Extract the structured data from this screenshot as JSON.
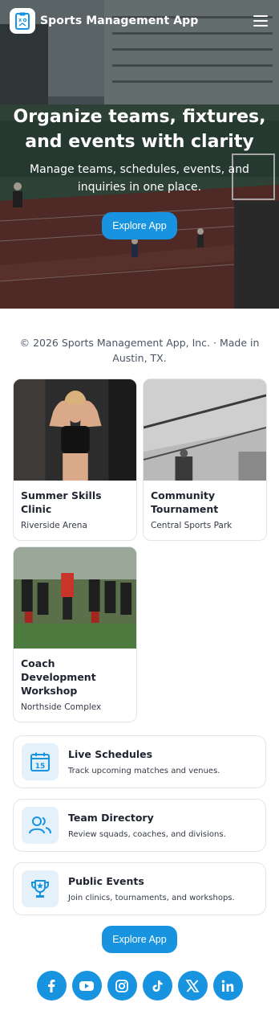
{
  "header": {
    "brand": "Sports Management App",
    "logo_icon": "clipboard-tactics-icon",
    "menu_icon": "hamburger-menu-icon"
  },
  "hero": {
    "title": "Organize teams, fixtures, and events with clarity",
    "subtitle": "Manage teams, schedules, events, and inquiries in one place.",
    "cta_label": "Explore App"
  },
  "copyright": "© 2026 Sports Management App, Inc. · Made in Austin, TX.",
  "events": [
    {
      "title": "Summer Skills Clinic",
      "location": "Riverside Arena",
      "image": "fitness-athlete-photo"
    },
    {
      "title": "Community Tournament",
      "location": "Central Sports Park",
      "image": "indoor-gym-photo"
    },
    {
      "title": "Coach Development Workshop",
      "location": "Northside Complex",
      "image": "football-team-photo"
    }
  ],
  "features": [
    {
      "title": "Live Schedules",
      "description": "Track upcoming matches and venues.",
      "icon": "calendar-icon",
      "icon_text": "15"
    },
    {
      "title": "Team Directory",
      "description": "Review squads, coaches, and divisions.",
      "icon": "users-icon"
    },
    {
      "title": "Public Events",
      "description": "Join clinics, tournaments, and workshops.",
      "icon": "trophy-icon"
    }
  ],
  "bottom_cta_label": "Explore App",
  "social": [
    "facebook-icon",
    "youtube-icon",
    "instagram-icon",
    "tiktok-icon",
    "x-icon",
    "linkedin-icon"
  ],
  "colors": {
    "accent": "#1793e0",
    "icon_bg": "#e4f1fb",
    "border": "#e2e4e8"
  }
}
